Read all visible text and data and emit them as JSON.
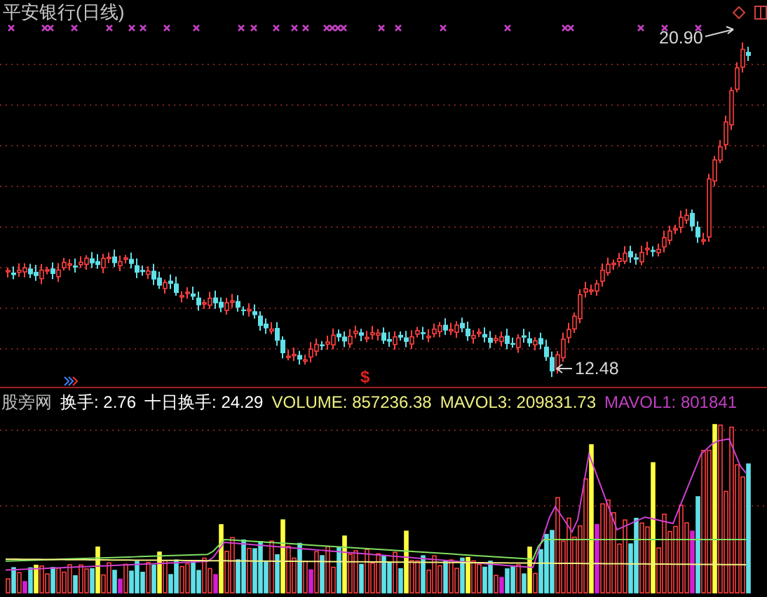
{
  "chart": {
    "title": "平安银行(日线)",
    "high_label": "20.90",
    "low_label": "12.48",
    "signal_glyph": "$"
  },
  "indicator_line": [
    {
      "text": "股旁网",
      "color": "#c0c0c0"
    },
    {
      "text": "换手: 2.76",
      "color": "#ffffff"
    },
    {
      "text": "十日换手: 24.29",
      "color": "#ffffff"
    },
    {
      "text": "VOLUME: 857236.38",
      "color": "#f0f080"
    },
    {
      "text": "MAVOL3: 209831.73",
      "color": "#f0f080"
    },
    {
      "text": "MAVOL1: 801841",
      "color": "#c040c0"
    }
  ]
}
